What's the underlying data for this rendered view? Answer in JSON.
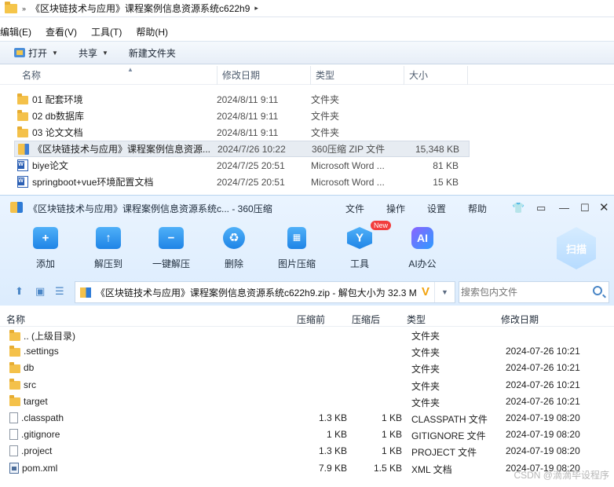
{
  "explorer": {
    "address": "《区块链技术与应用》课程案例信息资源系统c622h9",
    "menu": [
      "编辑(E)",
      "查看(V)",
      "工具(T)",
      "帮助(H)"
    ],
    "toolbar": {
      "open": "打开",
      "share": "共享",
      "new_folder": "新建文件夹"
    },
    "columns": {
      "name": "名称",
      "date": "修改日期",
      "type": "类型",
      "size": "大小"
    },
    "files": [
      {
        "name": "01 配套环境",
        "date": "2024/8/11 9:11",
        "type": "文件夹",
        "size": "",
        "icon": "folder-icon"
      },
      {
        "name": "02 db数据库",
        "date": "2024/8/11 9:11",
        "type": "文件夹",
        "size": "",
        "icon": "folder-icon"
      },
      {
        "name": "03 论文文档",
        "date": "2024/8/11 9:11",
        "type": "文件夹",
        "size": "",
        "icon": "folder-icon"
      },
      {
        "name": "《区块链技术与应用》课程案例信息资源...",
        "date": "2024/7/26 10:22",
        "type": "360压缩 ZIP 文件",
        "size": "15,348 KB",
        "icon": "zip-file-icon",
        "selected": true
      },
      {
        "name": "biye论文",
        "date": "2024/7/25 20:51",
        "type": "Microsoft Word ...",
        "size": "81 KB",
        "icon": "word-doc-icon"
      },
      {
        "name": "springboot+vue环境配置文档",
        "date": "2024/7/25 20:51",
        "type": "Microsoft Word ...",
        "size": "15 KB",
        "icon": "word-doc-icon"
      }
    ]
  },
  "zip": {
    "title": "《区块链技术与应用》课程案例信息资源系统c... - 360压缩",
    "menu": [
      "文件",
      "操作",
      "设置",
      "帮助"
    ],
    "tools": [
      {
        "label": "添加",
        "icon": "add-icon"
      },
      {
        "label": "解压到",
        "icon": "extract-to-icon"
      },
      {
        "label": "一键解压",
        "icon": "one-click-extract-icon"
      },
      {
        "label": "删除",
        "icon": "delete-icon"
      },
      {
        "label": "图片压缩",
        "icon": "image-compress-icon"
      },
      {
        "label": "工具",
        "icon": "tools-icon",
        "badge": "New"
      },
      {
        "label": "AI办公",
        "icon": "ai-office-icon"
      }
    ],
    "scan_label": "扫描",
    "path": "《区块链技术与应用》课程案例信息资源系统c622h9.zip - 解包大小为 32.3 M",
    "search_placeholder": "搜索包内文件",
    "columns": {
      "name": "名称",
      "before": "压缩前",
      "after": "压缩后",
      "type": "类型",
      "date": "修改日期"
    },
    "entries": [
      {
        "name": ".. (上级目录)",
        "before": "",
        "after": "",
        "type": "文件夹",
        "date": "",
        "icon": "folder-icon"
      },
      {
        "name": ".settings",
        "before": "",
        "after": "",
        "type": "文件夹",
        "date": "2024-07-26 10:21",
        "icon": "folder-icon"
      },
      {
        "name": "db",
        "before": "",
        "after": "",
        "type": "文件夹",
        "date": "2024-07-26 10:21",
        "icon": "folder-icon"
      },
      {
        "name": "src",
        "before": "",
        "after": "",
        "type": "文件夹",
        "date": "2024-07-26 10:21",
        "icon": "folder-icon"
      },
      {
        "name": "target",
        "before": "",
        "after": "",
        "type": "文件夹",
        "date": "2024-07-26 10:21",
        "icon": "folder-icon"
      },
      {
        "name": ".classpath",
        "before": "1.3 KB",
        "after": "1 KB",
        "type": "CLASSPATH 文件",
        "date": "2024-07-19 08:20",
        "icon": "file-icon"
      },
      {
        "name": ".gitignore",
        "before": "1 KB",
        "after": "1 KB",
        "type": "GITIGNORE 文件",
        "date": "2024-07-19 08:20",
        "icon": "file-icon"
      },
      {
        "name": ".project",
        "before": "1.3 KB",
        "after": "1 KB",
        "type": "PROJECT 文件",
        "date": "2024-07-19 08:20",
        "icon": "file-icon"
      },
      {
        "name": "pom.xml",
        "before": "7.9 KB",
        "after": "1.5 KB",
        "type": "XML 文档",
        "date": "2024-07-19 08:20",
        "icon": "xml-file-icon"
      }
    ]
  },
  "watermark": "CSDN @滴滴毕设程序"
}
